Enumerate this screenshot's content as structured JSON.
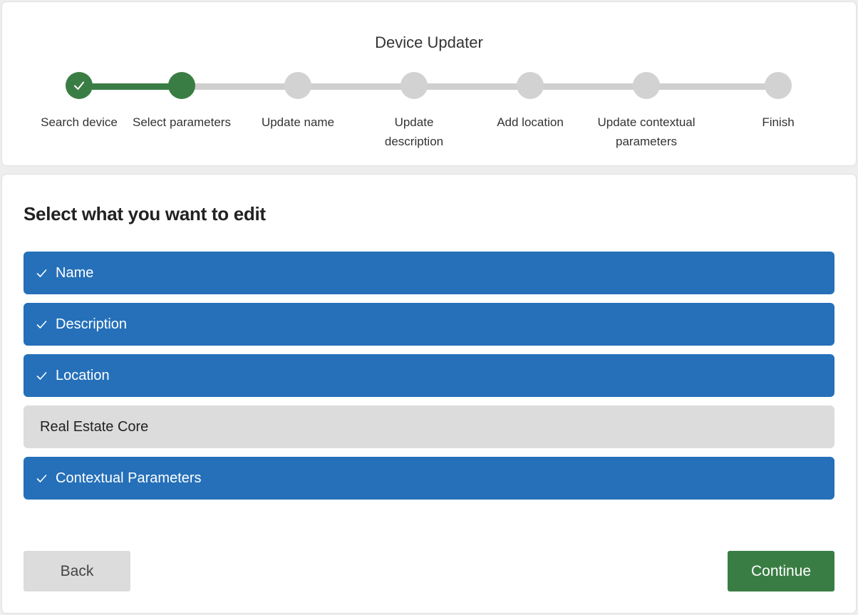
{
  "app": {
    "title": "Device Updater"
  },
  "stepper": {
    "steps": [
      {
        "label": "Search device",
        "state": "complete"
      },
      {
        "label": "Select parameters",
        "state": "active"
      },
      {
        "label": "Update name",
        "state": "pending"
      },
      {
        "label": "Update description",
        "state": "pending"
      },
      {
        "label": "Add location",
        "state": "pending"
      },
      {
        "label": "Update contextual parameters",
        "state": "pending"
      },
      {
        "label": "Finish",
        "state": "pending"
      }
    ]
  },
  "main": {
    "title": "Select what you want to edit",
    "options": [
      {
        "label": "Name",
        "selected": true
      },
      {
        "label": "Description",
        "selected": true
      },
      {
        "label": "Location",
        "selected": true
      },
      {
        "label": "Real Estate Core",
        "selected": false
      },
      {
        "label": "Contextual Parameters",
        "selected": true
      }
    ]
  },
  "actions": {
    "back_label": "Back",
    "continue_label": "Continue"
  },
  "icons": {
    "step_complete": "check-icon",
    "option_selected": "check-icon"
  },
  "colors": {
    "accent_green": "#3a7d44",
    "selected_blue": "#2570b9",
    "inactive_gray": "#d2d2d2"
  }
}
